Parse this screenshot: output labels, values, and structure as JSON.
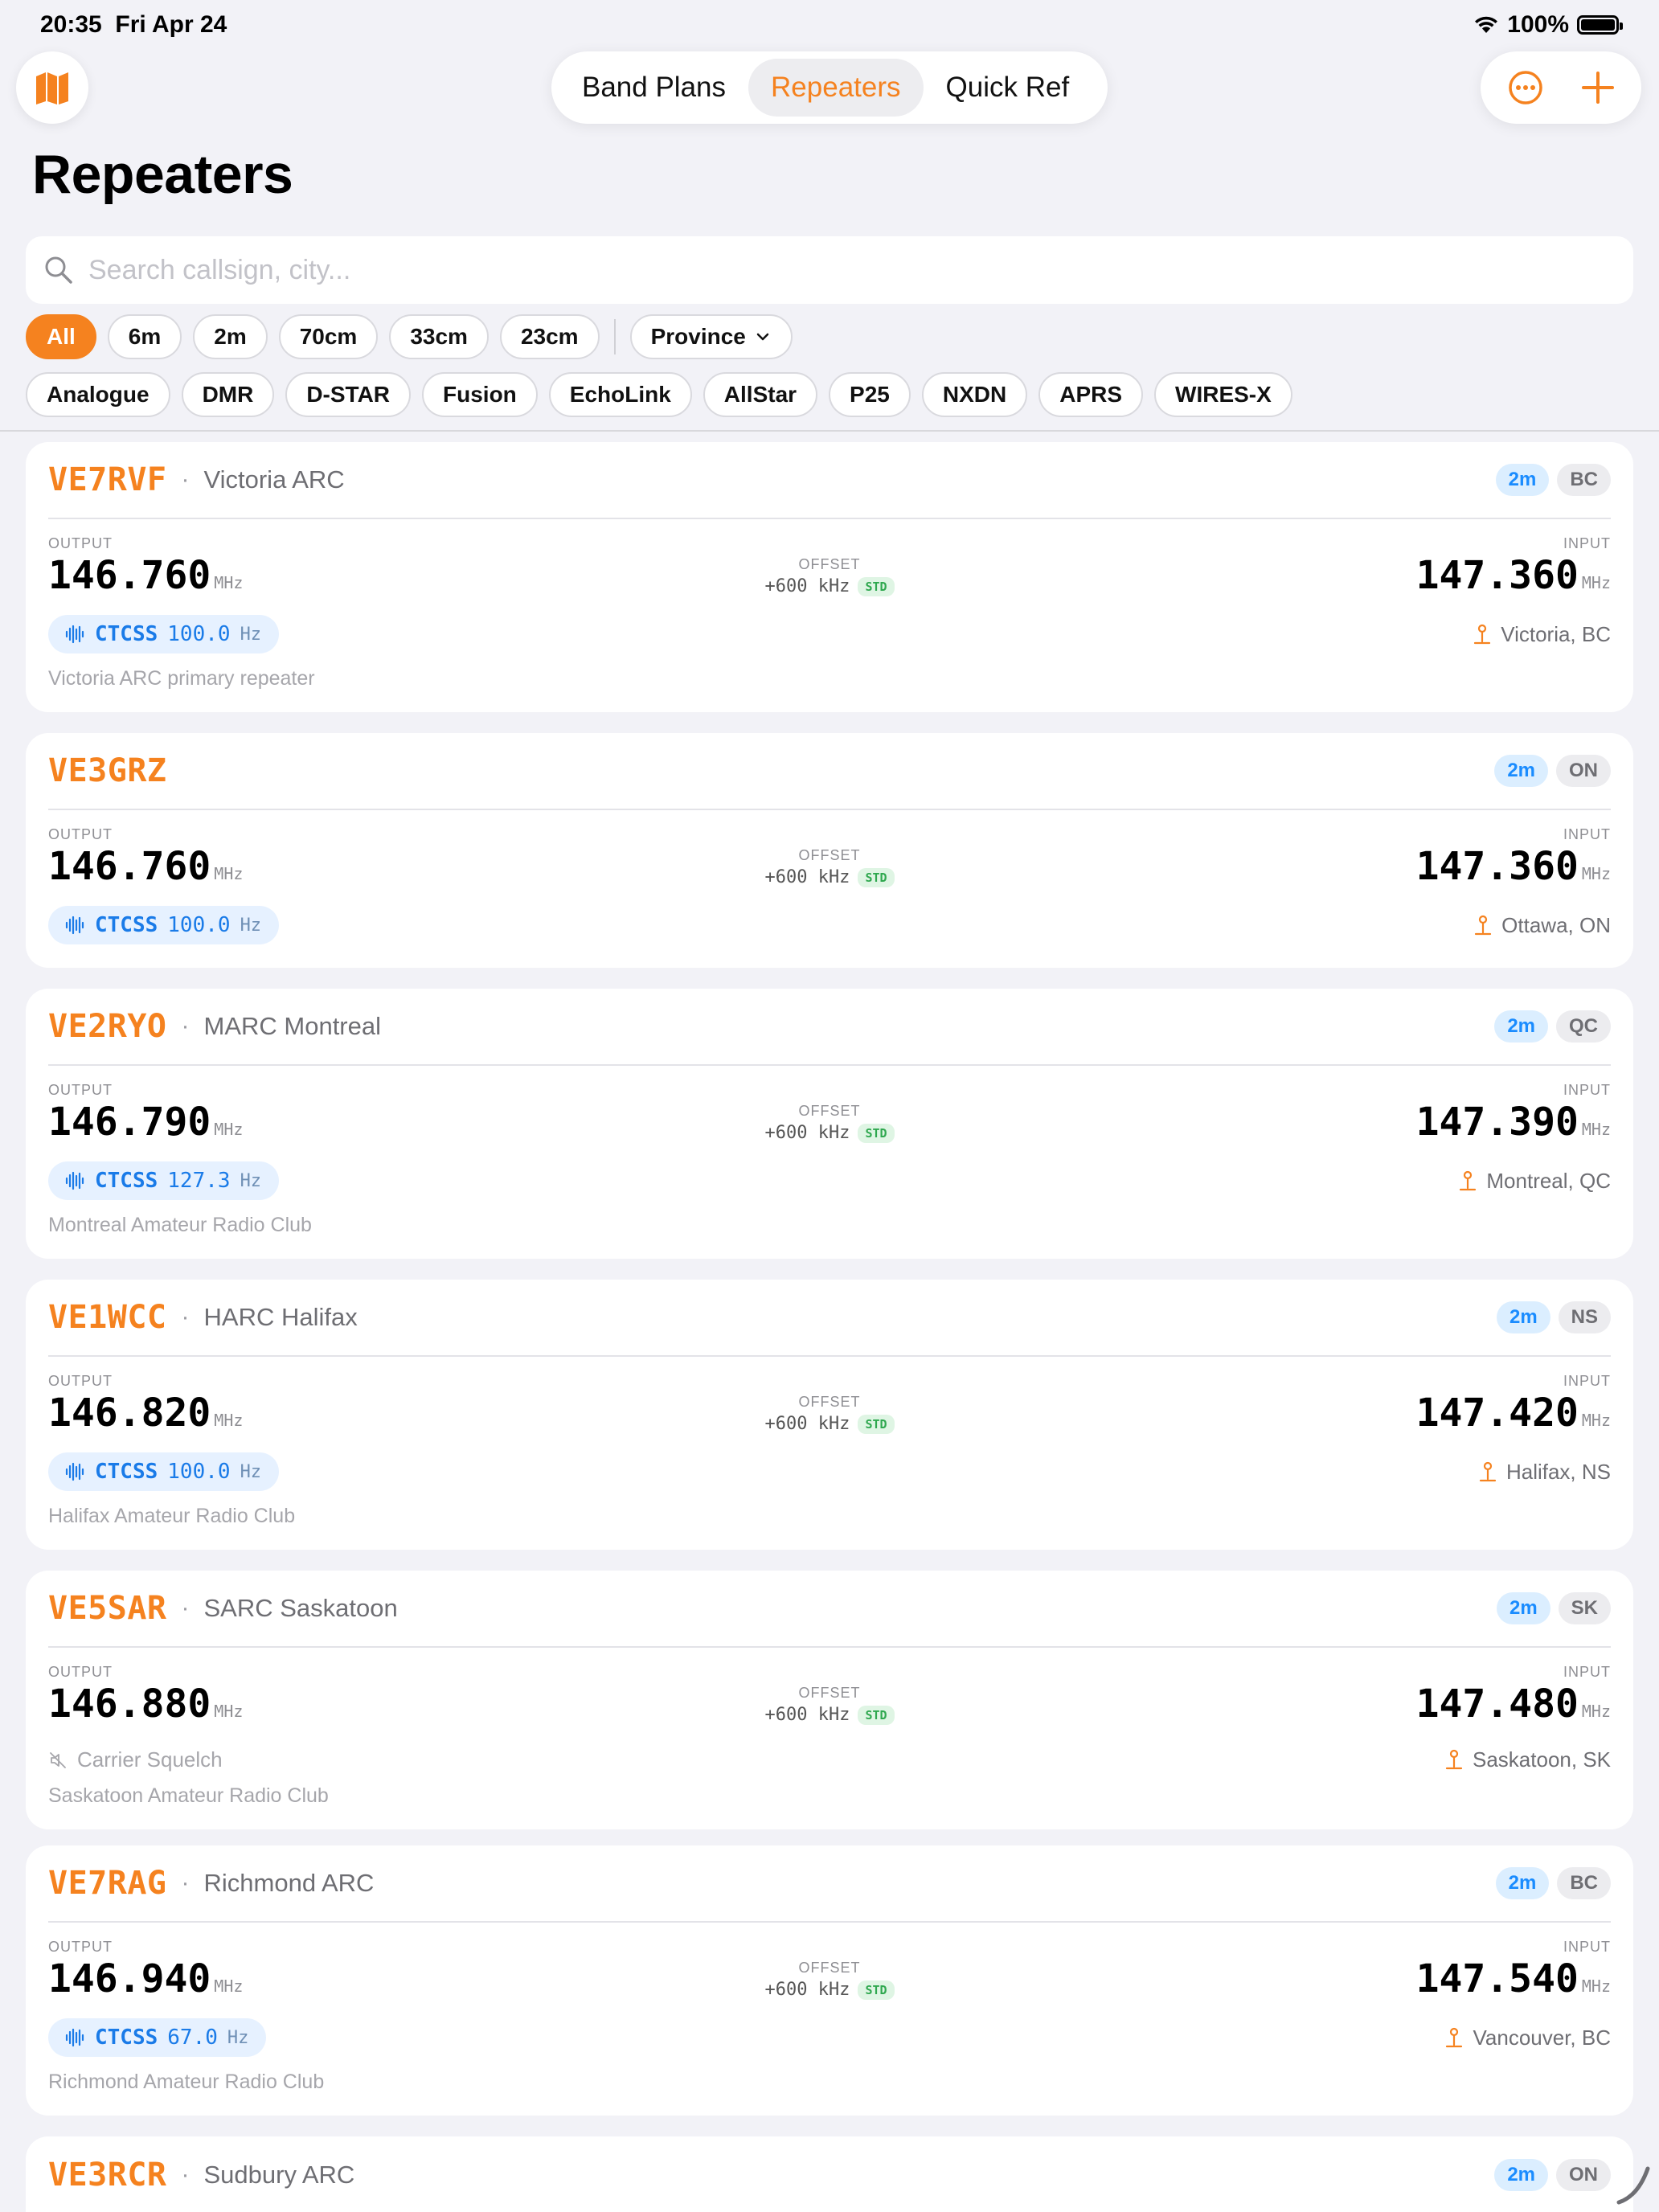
{
  "status": {
    "time": "20:35",
    "date": "Fri Apr 24",
    "battery": "100%"
  },
  "colors": {
    "accent": "#f5821f",
    "band_badge": "#1a8cff",
    "tone": "#1a7be8",
    "std": "#2fa84f"
  },
  "nav": {
    "left_icon": "map-icon",
    "segments": [
      {
        "label": "Band Plans"
      },
      {
        "label": "Repeaters",
        "active": true
      },
      {
        "label": "Quick Ref"
      }
    ],
    "right_icons": [
      "more-icon",
      "plus-icon"
    ]
  },
  "page_title": "Repeaters",
  "search": {
    "placeholder": "Search callsign, city..."
  },
  "band_chips": [
    "All",
    "6m",
    "2m",
    "70cm",
    "33cm",
    "23cm"
  ],
  "province_label": "Province",
  "mode_chips": [
    "Analogue",
    "DMR",
    "D-STAR",
    "Fusion",
    "EchoLink",
    "AllStar",
    "P25",
    "NXDN",
    "APRS",
    "WIRES-X"
  ],
  "labels": {
    "output": "OUTPUT",
    "input": "INPUT",
    "offset": "OFFSET",
    "unit": "MHz",
    "std": "STD"
  },
  "repeaters": [
    {
      "callsign": "VE7RVF",
      "club": "Victoria ARC",
      "band": "2m",
      "prov": "BC",
      "output": "146.760",
      "input": "147.360",
      "offset": "+600 kHz",
      "tone_type": "CTCSS",
      "tone": "100.0",
      "tone_unit": "Hz",
      "location": "Victoria, BC",
      "description": "Victoria ARC primary repeater"
    },
    {
      "callsign": "VE3GRZ",
      "club": "",
      "band": "2m",
      "prov": "ON",
      "output": "146.760",
      "input": "147.360",
      "offset": "+600 kHz",
      "tone_type": "CTCSS",
      "tone": "100.0",
      "tone_unit": "Hz",
      "location": "Ottawa, ON",
      "description": ""
    },
    {
      "callsign": "VE2RYO",
      "club": "MARC Montreal",
      "band": "2m",
      "prov": "QC",
      "output": "146.790",
      "input": "147.390",
      "offset": "+600 kHz",
      "tone_type": "CTCSS",
      "tone": "127.3",
      "tone_unit": "Hz",
      "location": "Montreal, QC",
      "description": "Montreal Amateur Radio Club"
    },
    {
      "callsign": "VE1WCC",
      "club": "HARC Halifax",
      "band": "2m",
      "prov": "NS",
      "output": "146.820",
      "input": "147.420",
      "offset": "+600 kHz",
      "tone_type": "CTCSS",
      "tone": "100.0",
      "tone_unit": "Hz",
      "location": "Halifax, NS",
      "description": "Halifax Amateur Radio Club"
    },
    {
      "callsign": "VE5SAR",
      "club": "SARC Saskatoon",
      "band": "2m",
      "prov": "SK",
      "output": "146.880",
      "input": "147.480",
      "offset": "+600 kHz",
      "carrier": "Carrier Squelch",
      "location": "Saskatoon, SK",
      "description": "Saskatoon Amateur Radio Club"
    },
    {
      "callsign": "VE7RAG",
      "club": "Richmond ARC",
      "band": "2m",
      "prov": "BC",
      "output": "146.940",
      "input": "147.540",
      "offset": "+600 kHz",
      "tone_type": "CTCSS",
      "tone": "67.0",
      "tone_unit": "Hz",
      "location": "Vancouver, BC",
      "description": "Richmond Amateur Radio Club"
    },
    {
      "callsign": "VE3RCR",
      "club": "Sudbury ARC",
      "band": "2m",
      "prov": "ON"
    }
  ]
}
